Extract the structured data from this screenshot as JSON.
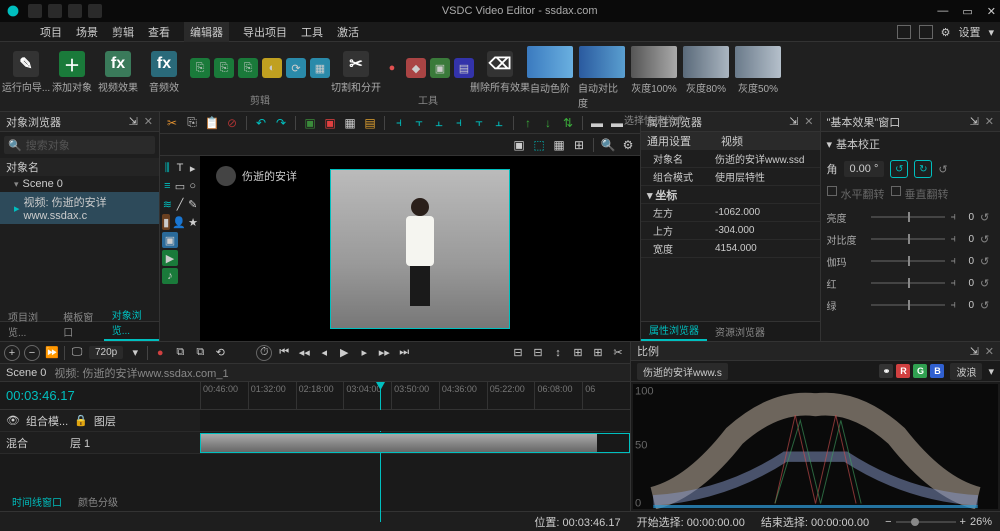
{
  "title": "VSDC Video Editor - ssdax.com",
  "menus": [
    "项目",
    "场景",
    "剪辑",
    "查看",
    "编辑器",
    "导出项目",
    "工具",
    "激活"
  ],
  "menu_active_index": 4,
  "settings_label": "设置",
  "ribbon": {
    "run_guide": "运行向导...",
    "add_object": "添加对象",
    "video_fx": "视频效果",
    "audio_fx": "音频效",
    "edit_group": "剪辑",
    "cut_split": "切割和分开",
    "tools_group": "工具",
    "remove_all": "删除所有效果",
    "auto_levels": "自动色阶",
    "auto_contrast": "自动对比度",
    "gray100": "灰度100%",
    "gray80": "灰度80%",
    "gray50": "灰度50%",
    "quick_styles": "选择快捷样式"
  },
  "left": {
    "browser_title": "对象浏览器",
    "search_placeholder": "搜索对象",
    "objects_hdr": "对象名",
    "scene": "Scene 0",
    "video_item": "视频: 伤逝的安详www.ssdax.c",
    "tabs": [
      "项目浏览...",
      "模板窗口",
      "对象浏览..."
    ],
    "tabs_active": 2
  },
  "watermark": "伤逝的安详",
  "props": {
    "title": "属性浏览器",
    "general": "通用设置",
    "video_col": "视频",
    "rows": [
      {
        "k": "对象名",
        "v": "伤逝的安详www.ssd"
      },
      {
        "k": "组合模式",
        "v": "使用层特性"
      }
    ],
    "coord_hdr": "坐标",
    "coords": [
      {
        "k": "左方",
        "v": "-1062.000"
      },
      {
        "k": "上方",
        "v": "-304.000"
      },
      {
        "k": "宽度",
        "v": "4154.000"
      }
    ],
    "tabs": [
      "属性浏览器",
      "资源浏览器"
    ]
  },
  "effects": {
    "title": "\"基本效果\"窗口",
    "basic_corr": "基本校正",
    "angle_label": "角",
    "angle_value": "0.00 °",
    "hflip": "水平翻转",
    "vflip": "垂直翻转",
    "sliders": [
      {
        "lbl": "亮度",
        "val": "0"
      },
      {
        "lbl": "对比度",
        "val": "0"
      },
      {
        "lbl": "伽玛",
        "val": "0"
      },
      {
        "lbl": "红",
        "val": "0"
      },
      {
        "lbl": "绿",
        "val": "0"
      }
    ]
  },
  "timeline": {
    "resolution": "720p",
    "scene_hdr_a": "Scene 0",
    "scene_hdr_b": "视频: 伤逝的安详www.ssdax.com_1",
    "timecode": "00:03:46.17",
    "ticks": [
      "00:46:00",
      "01:32:00",
      "02:18:00",
      "03:04:00",
      "03:50:00",
      "04:36:00",
      "05:22:00",
      "06:08:00",
      "06"
    ],
    "track1_a": "组合模...",
    "track1_b": "图层",
    "track2_a": "混合",
    "track2_b": "层 1",
    "tabs": [
      "时间线窗口",
      "颜色分级"
    ]
  },
  "scopes": {
    "title": "比例",
    "chip": "伤逝的安详www.s",
    "mode": "波浪",
    "ylabels": [
      "100",
      "50",
      "0"
    ]
  },
  "status": {
    "position": "位置:",
    "position_v": "00:03:46.17",
    "sel_start": "开始选择:",
    "sel_start_v": "00:00:00.00",
    "sel_end": "结束选择:",
    "sel_end_v": "00:00:00.00",
    "zoom": "26%"
  }
}
